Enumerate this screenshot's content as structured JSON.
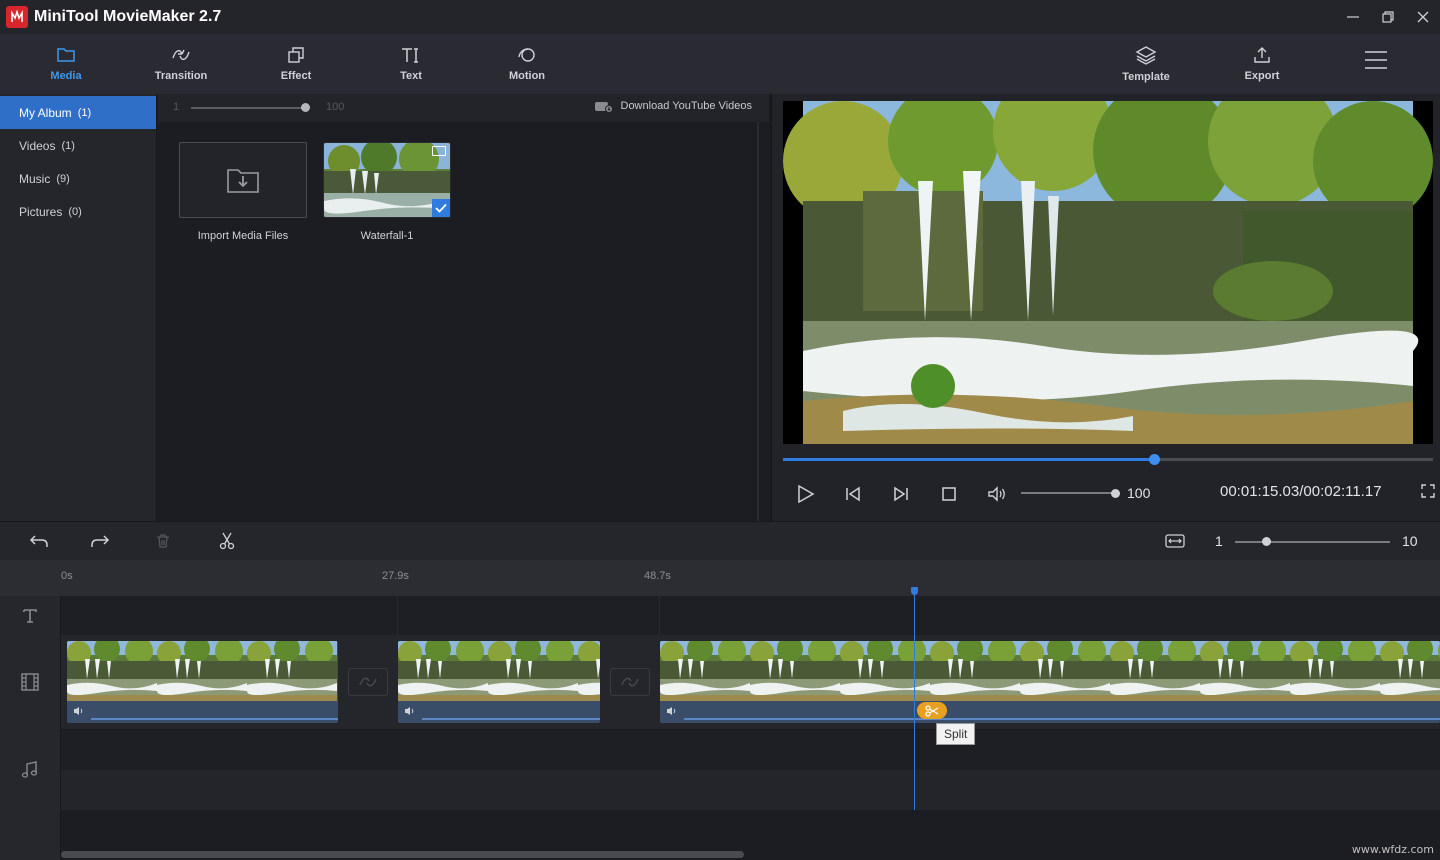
{
  "app": {
    "title": "MiniTool MovieMaker 2.7"
  },
  "toolbar": {
    "media": "Media",
    "transition": "Transition",
    "effect": "Effect",
    "text": "Text",
    "motion": "Motion",
    "template": "Template",
    "export": "Export"
  },
  "sidebar": {
    "items": [
      {
        "label": "My Album",
        "count": "(1)"
      },
      {
        "label": "Videos",
        "count": "(1)"
      },
      {
        "label": "Music",
        "count": "(9)"
      },
      {
        "label": "Pictures",
        "count": "(0)"
      }
    ]
  },
  "media": {
    "size_min": "1",
    "size_max": "100",
    "download_youtube": "Download YouTube Videos",
    "import_label": "Import Media Files",
    "clip_label": "Waterfall-1"
  },
  "preview": {
    "progress_fraction": 0.57,
    "volume": "100",
    "timecode": "00:01:15.03/00:02:11.17"
  },
  "timeline": {
    "zoom_min": "1",
    "zoom_max": "10",
    "ruler_marks": [
      "0s",
      "27.9s",
      "48.7s"
    ],
    "split_tooltip": "Split"
  },
  "watermark": "www.wfdz.com",
  "icons": {
    "media": "folder-icon",
    "transition": "transition-icon",
    "effect": "effect-icon",
    "text": "text-icon",
    "motion": "motion-icon",
    "template": "layers-icon",
    "export": "upload-icon"
  },
  "colors": {
    "accent": "#2f7be0",
    "split": "#e8a022"
  }
}
